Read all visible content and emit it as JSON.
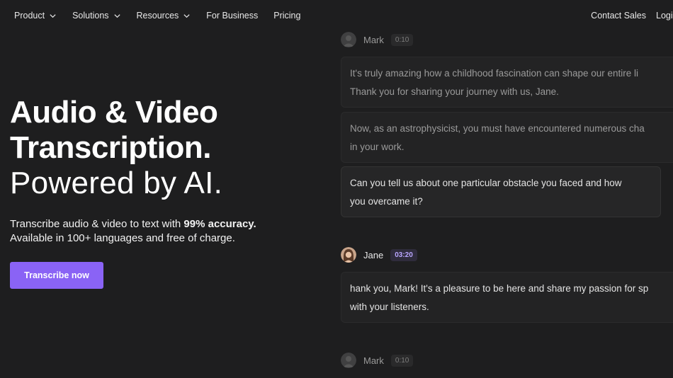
{
  "nav": {
    "items": [
      {
        "label": "Product",
        "dropdown": true
      },
      {
        "label": "Solutions",
        "dropdown": true
      },
      {
        "label": "Resources",
        "dropdown": true
      },
      {
        "label": "For Business",
        "dropdown": false
      },
      {
        "label": "Pricing",
        "dropdown": false
      }
    ],
    "contact_sales": "Contact Sales",
    "login": "Login"
  },
  "hero": {
    "title_line1": "Audio & Video",
    "title_line2": "Transcription.",
    "title_line3": "Powered by AI.",
    "sub_line1_prefix": "Transcribe audio & video to text with ",
    "sub_line1_bold": "99% accuracy.",
    "sub_line2": "Available in 100+ languages and free of charge.",
    "cta_label": "Transcribe now"
  },
  "transcript": [
    {
      "speaker": "Mark",
      "time": "0:10",
      "active": false,
      "bubbles": [
        {
          "line1": "It's truly amazing how a childhood fascination can shape our entire li",
          "line2": "Thank you for sharing your journey with us, Jane."
        },
        {
          "line1": "Now, as an astrophysicist, you must have encountered numerous cha",
          "line2": "in your work."
        },
        {
          "line1": "Can you tell us about one particular obstacle you faced and how",
          "line2": "you overcame it?"
        }
      ]
    },
    {
      "speaker": "Jane",
      "time": "03:20",
      "active": true,
      "bubbles": [
        {
          "line1": "hank you, Mark! It's a pleasure to be here and share my passion for sp",
          "line2": "with your listeners."
        }
      ]
    },
    {
      "speaker": "Mark",
      "time": "0:10",
      "active": false,
      "bubbles": []
    }
  ],
  "colors": {
    "accent": "#8a63f5",
    "background": "#1e1e1f",
    "timestamp_active": "#b9a6ff"
  }
}
